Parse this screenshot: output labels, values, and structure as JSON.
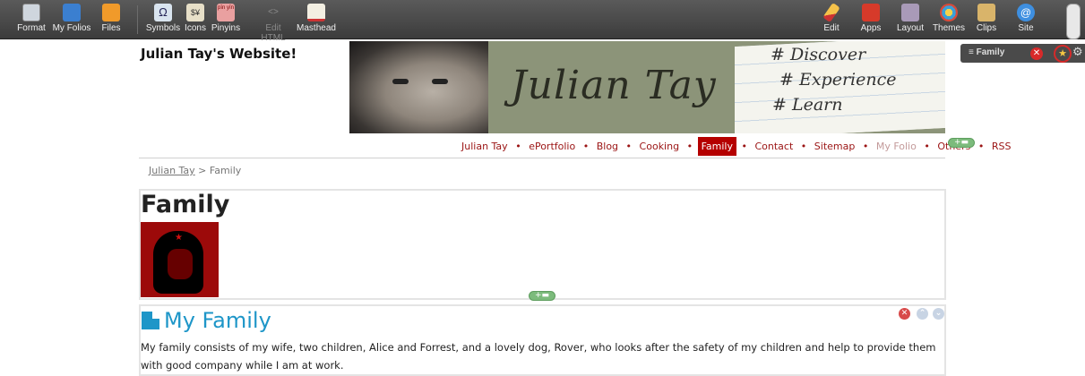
{
  "toolbar": {
    "left": [
      {
        "label": "Format",
        "icon": "format-grid-icon"
      },
      {
        "label": "My Folios",
        "icon": "folios-icon"
      },
      {
        "label": "Files",
        "icon": "files-icon"
      },
      {
        "label": "Symbols",
        "icon": "omega-icon"
      },
      {
        "label": "Icons",
        "icon": "icons-icon"
      },
      {
        "label": "Pinyins",
        "icon": "pinyin-icon"
      },
      {
        "label": "Edit HTML",
        "icon": "code-icon",
        "disabled": true
      },
      {
        "label": "Masthead",
        "icon": "masthead-icon"
      }
    ],
    "right": [
      {
        "label": "Edit",
        "icon": "pencil-icon"
      },
      {
        "label": "Apps",
        "icon": "toolbox-icon"
      },
      {
        "label": "Layout",
        "icon": "layout-icon"
      },
      {
        "label": "Themes",
        "icon": "palette-icon"
      },
      {
        "label": "Clips",
        "icon": "clips-icon"
      },
      {
        "label": "Site",
        "icon": "globe-icon"
      }
    ],
    "symbols_glyph": "Ω",
    "icons_glyph": "$¥",
    "pinyin_glyph": "pīn yīn",
    "edit_html_glyph": "<>"
  },
  "right_panel": {
    "title": "≡ Family",
    "close_glyph": "✕",
    "star_glyph": "★",
    "gear_glyph": "⚙"
  },
  "site": {
    "title": "Julian Tay's Website!",
    "masthead_name": "Julian Tay",
    "masthead_lines": [
      "# Discover",
      "# Experience",
      "# Learn"
    ]
  },
  "nav": {
    "items": [
      {
        "label": "Julian Tay"
      },
      {
        "label": "ePortfolio"
      },
      {
        "label": "Blog"
      },
      {
        "label": "Cooking"
      },
      {
        "label": "Family",
        "active": true
      },
      {
        "label": "Contact"
      },
      {
        "label": "Sitemap"
      },
      {
        "label": "My Folio",
        "muted": true
      },
      {
        "label": "Others"
      },
      {
        "label": "RSS"
      }
    ],
    "separator": "•",
    "add_glyph": "+▬"
  },
  "breadcrumb": {
    "link": "Julian Tay",
    "rest": " > Family"
  },
  "family_section": {
    "heading": "Family",
    "add_glyph": "+▬"
  },
  "my_family": {
    "title": "My Family",
    "body": "My family consists of my wife, two children, Alice and Forrest, and a lovely dog, Rover, who looks after the safety of my children and help to provide them with good company while I am at work.",
    "close_glyph": "✕",
    "up_glyph": "⌃",
    "down_glyph": "⌄"
  },
  "colors": {
    "nav_link": "#9b1414",
    "nav_active_bg": "#b50000",
    "heading_blue": "#1e96c8"
  }
}
